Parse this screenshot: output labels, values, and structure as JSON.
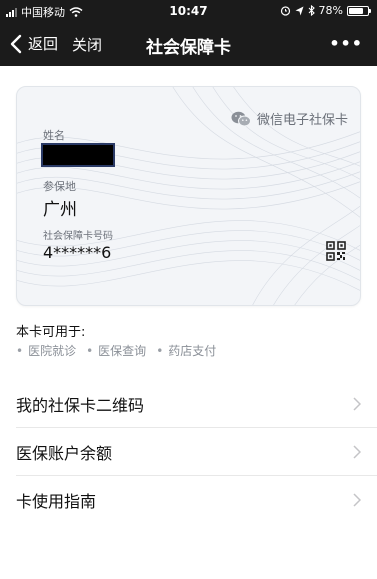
{
  "status_bar": {
    "carrier": "中国移动",
    "time": "10:47",
    "battery": "78%",
    "battery_level": 0.78,
    "icons": [
      "signal-icon",
      "wifi-icon",
      "alarm-icon",
      "location-icon",
      "bluetooth-icon",
      "battery-icon"
    ]
  },
  "nav": {
    "back_label": "返回",
    "close_label": "关闭",
    "title": "社会保障卡",
    "more_label": "•••"
  },
  "card": {
    "brand_label": "微信电子社保卡",
    "name_label": "姓名",
    "location_label": "参保地",
    "location_value": "广州",
    "card_no_label": "社会保障卡号码",
    "card_no_value": "4******6",
    "colors": {
      "background": "#f3f5f8",
      "wave": "#d5dae2",
      "text_muted": "#6b7079"
    }
  },
  "usage": {
    "title": "本卡可用于:",
    "items": [
      "医院就诊",
      "医保查询",
      "药店支付"
    ]
  },
  "menu": [
    {
      "label": "我的社保卡二维码"
    },
    {
      "label": "医保账户余额"
    },
    {
      "label": "卡使用指南"
    }
  ]
}
